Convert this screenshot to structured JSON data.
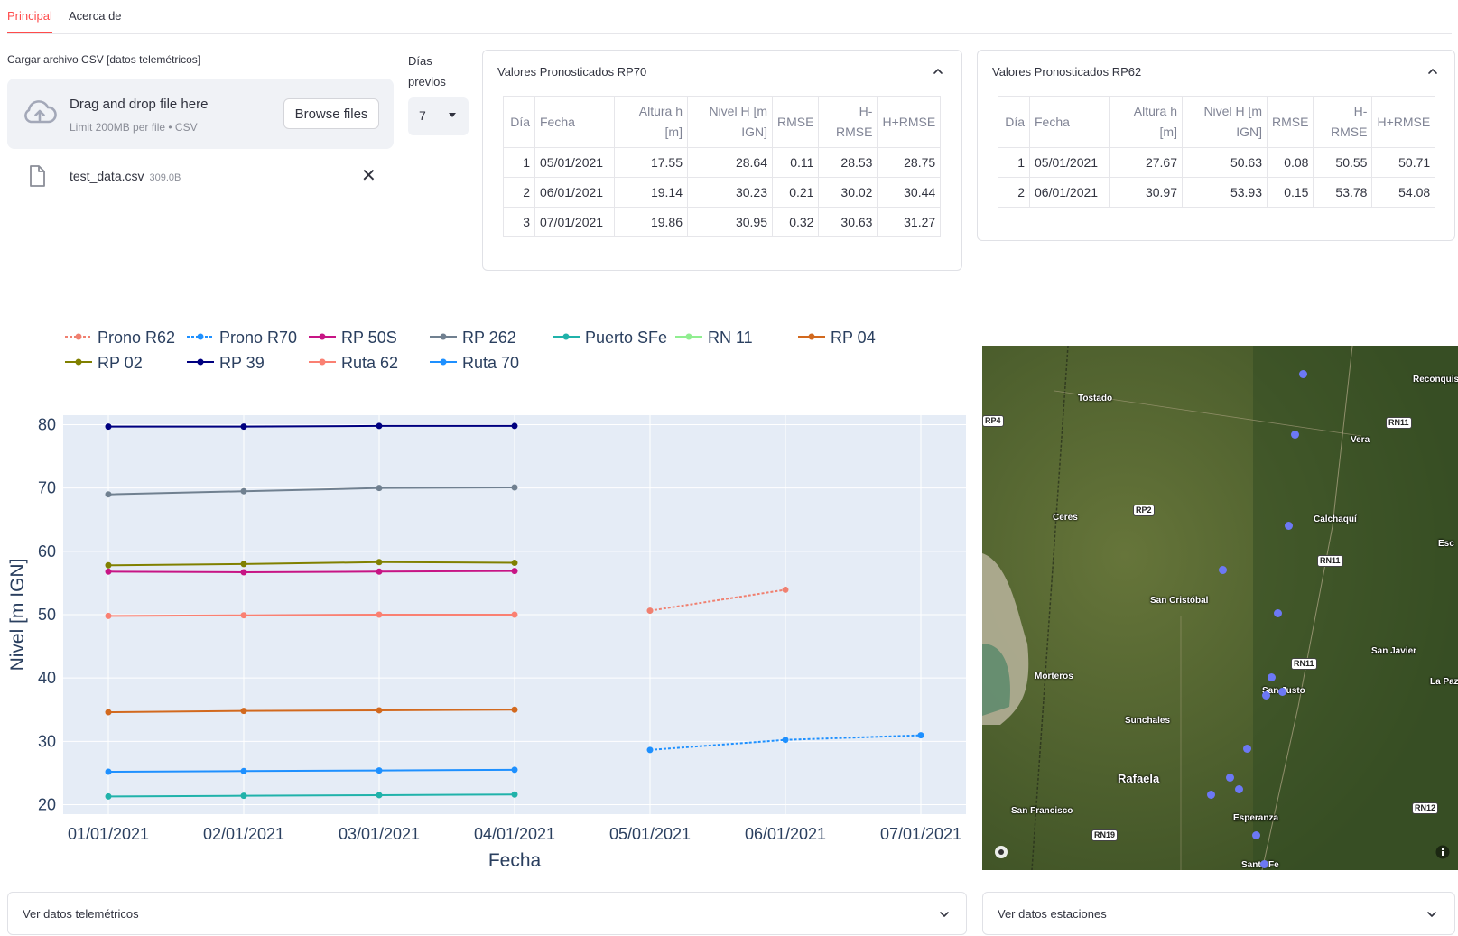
{
  "tabs": [
    {
      "label": "Principal",
      "active": true
    },
    {
      "label": "Acerca de",
      "active": false
    }
  ],
  "uploader": {
    "label": "Cargar archivo CSV [datos telemétricos]",
    "drop_title": "Drag and drop file here",
    "limit": "Limit 200MB per file • CSV",
    "browse_label": "Browse files",
    "file_name": "test_data.csv",
    "file_size": "309.0B"
  },
  "dias": {
    "label": "Días previos",
    "value": "7"
  },
  "rp70": {
    "title": "Valores Pronosticados RP70",
    "headers": [
      "Día",
      "Fecha",
      "Altura h [m]",
      "Nivel H [m IGN]",
      "RMSE",
      "H-RMSE",
      "H+RMSE"
    ],
    "rows": [
      [
        "1",
        "05/01/2021",
        "17.55",
        "28.64",
        "0.11",
        "28.53",
        "28.75"
      ],
      [
        "2",
        "06/01/2021",
        "19.14",
        "30.23",
        "0.21",
        "30.02",
        "30.44"
      ],
      [
        "3",
        "07/01/2021",
        "19.86",
        "30.95",
        "0.32",
        "30.63",
        "31.27"
      ]
    ]
  },
  "rp62": {
    "title": "Valores Pronosticados RP62",
    "headers": [
      "Día",
      "Fecha",
      "Altura h [m]",
      "Nivel H [m IGN]",
      "RMSE",
      "H-RMSE",
      "H+RMSE"
    ],
    "rows": [
      [
        "1",
        "05/01/2021",
        "27.67",
        "50.63",
        "0.08",
        "50.55",
        "50.71"
      ],
      [
        "2",
        "06/01/2021",
        "30.97",
        "53.93",
        "0.15",
        "53.78",
        "54.08"
      ]
    ]
  },
  "chart_data": {
    "type": "line",
    "xlabel": "Fecha",
    "ylabel": "Nivel [m IGN]",
    "x": [
      "01/01/2021",
      "02/01/2021",
      "03/01/2021",
      "04/01/2021",
      "05/01/2021",
      "06/01/2021",
      "07/01/2021"
    ],
    "ylim": [
      18.5,
      81.5
    ],
    "yticks": [
      20,
      30,
      40,
      50,
      60,
      70,
      80
    ],
    "legend_position": "top",
    "grid": true,
    "series": [
      {
        "name": "Prono R62",
        "color": "#f08070",
        "dash": true,
        "x": [
          4,
          5
        ],
        "values": [
          50.63,
          53.93
        ]
      },
      {
        "name": "Prono R70",
        "color": "#1e90ff",
        "dash": true,
        "x": [
          4,
          5,
          6
        ],
        "values": [
          28.64,
          30.23,
          30.95
        ]
      },
      {
        "name": "RP 50S",
        "color": "#c71585",
        "dash": false,
        "x": [
          0,
          1,
          2,
          3
        ],
        "values": [
          56.8,
          56.7,
          56.8,
          56.9
        ]
      },
      {
        "name": "RP 262",
        "color": "#708090",
        "dash": false,
        "x": [
          0,
          1,
          2,
          3
        ],
        "values": [
          69.0,
          69.5,
          70.0,
          70.1
        ]
      },
      {
        "name": "Puerto SFe",
        "color": "#20b2aa",
        "dash": false,
        "x": [
          0,
          1,
          2,
          3
        ],
        "values": [
          21.3,
          21.4,
          21.5,
          21.6
        ]
      },
      {
        "name": "RN 11",
        "color": "#90ee90",
        "dash": false,
        "x": [],
        "values": []
      },
      {
        "name": "RP 04",
        "color": "#d2691e",
        "dash": false,
        "x": [
          0,
          1,
          2,
          3
        ],
        "values": [
          34.6,
          34.8,
          34.9,
          35.0
        ]
      },
      {
        "name": "RP 02",
        "color": "#808000",
        "dash": false,
        "x": [
          0,
          1,
          2,
          3
        ],
        "values": [
          57.8,
          58.0,
          58.3,
          58.2
        ]
      },
      {
        "name": "RP 39",
        "color": "#000080",
        "dash": false,
        "x": [
          0,
          1,
          2,
          3
        ],
        "values": [
          79.7,
          79.7,
          79.8,
          79.8
        ]
      },
      {
        "name": "Ruta 62",
        "color": "#fa8072",
        "dash": false,
        "x": [
          0,
          1,
          2,
          3
        ],
        "values": [
          49.8,
          49.9,
          50.0,
          50.0
        ]
      },
      {
        "name": "Ruta 70",
        "color": "#1e90ff",
        "dash": false,
        "x": [
          0,
          1,
          2,
          3
        ],
        "values": [
          25.2,
          25.3,
          25.4,
          25.5
        ]
      }
    ]
  },
  "map": {
    "places": [
      "Tostado",
      "Reconquista",
      "Vera",
      "Ceres",
      "Calchaquí",
      "San Cristóbal",
      "San Javier",
      "Morteros",
      "San Justo",
      "La Paz",
      "Sunchales",
      "Rafaela",
      "San Francisco",
      "Esperanza",
      "Esc",
      "Santa Fe"
    ],
    "roads": [
      "RN11",
      "RP2",
      "RN11",
      "RN11",
      "RN12",
      "RN19",
      "RP4"
    ],
    "station_count": 14
  },
  "bottom": {
    "left_label": "Ver datos telemétricos",
    "right_label": "Ver datos estaciones"
  }
}
